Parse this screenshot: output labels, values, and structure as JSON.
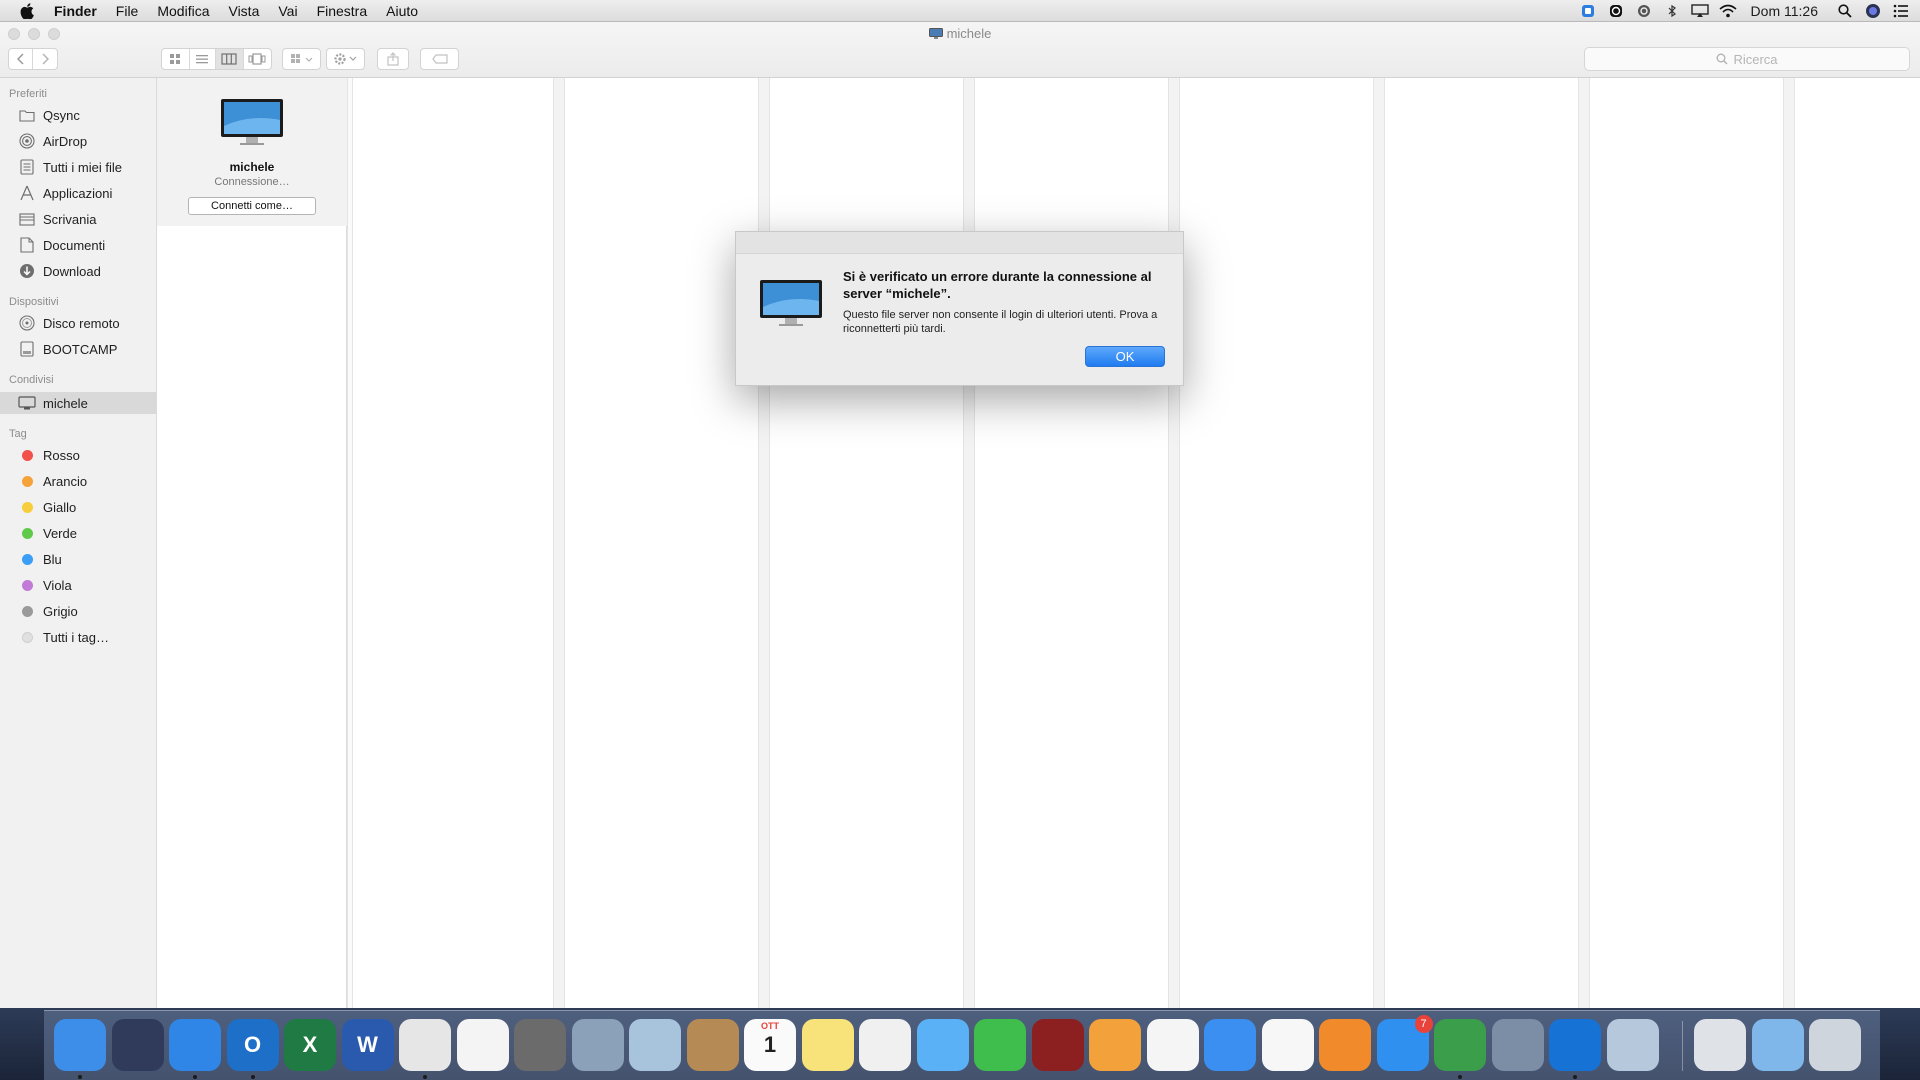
{
  "menubar": {
    "app_name": "Finder",
    "menus": [
      "File",
      "Modifica",
      "Vista",
      "Vai",
      "Finestra",
      "Aiuto"
    ],
    "clock": "Dom 11:26"
  },
  "window": {
    "title": "michele",
    "search_placeholder": "Ricerca"
  },
  "sidebar": {
    "favorites_heading": "Preferiti",
    "favorites": [
      {
        "label": "Qsync",
        "icon": "folder-icon"
      },
      {
        "label": "AirDrop",
        "icon": "airdrop-icon"
      },
      {
        "label": "Tutti i miei file",
        "icon": "all-files-icon"
      },
      {
        "label": "Applicazioni",
        "icon": "applications-icon"
      },
      {
        "label": "Scrivania",
        "icon": "desktop-icon"
      },
      {
        "label": "Documenti",
        "icon": "documents-icon"
      },
      {
        "label": "Download",
        "icon": "download-icon"
      }
    ],
    "devices_heading": "Dispositivi",
    "devices": [
      {
        "label": "Disco remoto",
        "icon": "remote-disc-icon"
      },
      {
        "label": "BOOTCAMP",
        "icon": "drive-icon"
      }
    ],
    "shared_heading": "Condivisi",
    "shared": [
      {
        "label": "michele",
        "icon": "computer-icon",
        "selected": true
      }
    ],
    "tags_heading": "Tag",
    "tags": [
      {
        "label": "Rosso",
        "color": "#f2514a"
      },
      {
        "label": "Arancio",
        "color": "#f5a23a"
      },
      {
        "label": "Giallo",
        "color": "#f6cd3c"
      },
      {
        "label": "Verde",
        "color": "#5fc94a"
      },
      {
        "label": "Blu",
        "color": "#3a9ef4"
      },
      {
        "label": "Viola",
        "color": "#c17ad6"
      },
      {
        "label": "Grigio",
        "color": "#9a9a9a"
      },
      {
        "label": "Tutti i tag…",
        "color": "#e0e0e0"
      }
    ]
  },
  "server": {
    "name": "michele",
    "status": "Connessione…",
    "connect_label": "Connetti come…"
  },
  "dialog": {
    "title": "Si è verificato un errore durante la connessione al server “michele”.",
    "message": "Questo file server non consente il login di ulteriori utenti. Prova a riconnetterti più tardi.",
    "ok_label": "OK"
  },
  "dock": {
    "apps": [
      {
        "name": "finder-icon",
        "color": "#3d8ee8",
        "running": true
      },
      {
        "name": "siri-icon",
        "color": "#303a5a",
        "running": false
      },
      {
        "name": "safari-icon",
        "color": "#2f86e6",
        "running": true
      },
      {
        "name": "outlook-icon",
        "color": "#1e6fc8",
        "running": true,
        "glyph": "O"
      },
      {
        "name": "excel-icon",
        "color": "#1f7a43",
        "running": false,
        "glyph": "X"
      },
      {
        "name": "word-icon",
        "color": "#2a5aae",
        "running": false,
        "glyph": "W"
      },
      {
        "name": "chrome-icon",
        "color": "#e6e6e6",
        "running": true
      },
      {
        "name": "photos-icon",
        "color": "#f4f4f4",
        "running": false
      },
      {
        "name": "system-preferences-icon",
        "color": "#6b6b6b",
        "running": false
      },
      {
        "name": "launchpad-icon",
        "color": "#8ba0b9",
        "running": false
      },
      {
        "name": "mail-stamp-icon",
        "color": "#a8c4dc",
        "running": false
      },
      {
        "name": "contacts-icon",
        "color": "#b68a55",
        "running": false
      },
      {
        "name": "calendar-icon",
        "color": "#fafafa",
        "running": false,
        "glyph": "1",
        "label": "OTT"
      },
      {
        "name": "notes-icon",
        "color": "#f8e27a",
        "running": false
      },
      {
        "name": "reminders-icon",
        "color": "#f0f0f0",
        "running": false
      },
      {
        "name": "messages-icon",
        "color": "#5ab1f5",
        "running": false
      },
      {
        "name": "facetime-icon",
        "color": "#3fbd4d",
        "running": false
      },
      {
        "name": "photo-booth-icon",
        "color": "#8c1f1f",
        "running": false
      },
      {
        "name": "pages-icon",
        "color": "#f3a13b",
        "running": false
      },
      {
        "name": "numbers-icon",
        "color": "#f5f5f5",
        "running": false
      },
      {
        "name": "keynote-icon",
        "color": "#3b8ff0",
        "running": false
      },
      {
        "name": "itunes-icon",
        "color": "#f7f7f7",
        "running": false
      },
      {
        "name": "ibooks-icon",
        "color": "#f08a2b",
        "running": false
      },
      {
        "name": "app-store-icon",
        "color": "#2f90f0",
        "running": false,
        "badge": "7"
      },
      {
        "name": "messenger-icon",
        "color": "#3b9e4a",
        "running": true
      },
      {
        "name": "network-radar-icon",
        "color": "#7c8ea6",
        "running": false
      },
      {
        "name": "teamviewer-icon",
        "color": "#1772d6",
        "running": true
      },
      {
        "name": "preview-icon",
        "color": "#b6c9dc",
        "running": false
      },
      {
        "name": "documents-stack-icon",
        "color": "#dfe3e8",
        "running": false
      },
      {
        "name": "folder-stack-icon",
        "color": "#7fb7ea",
        "running": false
      },
      {
        "name": "trash-icon",
        "color": "#cfd5dc",
        "running": false
      }
    ]
  }
}
